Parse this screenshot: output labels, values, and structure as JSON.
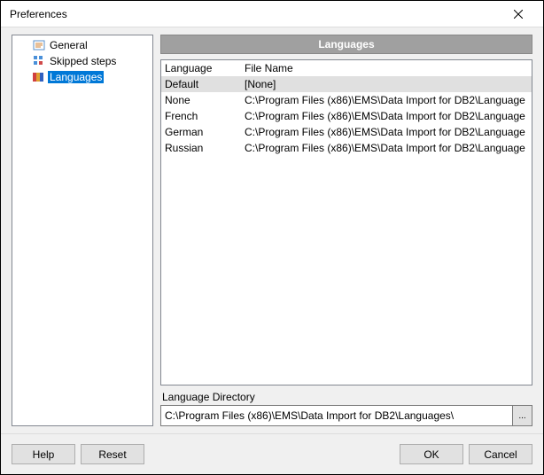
{
  "window": {
    "title": "Preferences"
  },
  "tree": {
    "items": [
      {
        "label": "General",
        "selected": false
      },
      {
        "label": "Skipped steps",
        "selected": false
      },
      {
        "label": "Languages",
        "selected": true
      }
    ]
  },
  "section": {
    "title": "Languages"
  },
  "grid": {
    "headers": {
      "language": "Language",
      "filename": "File Name"
    },
    "rows": [
      {
        "language": "Default",
        "filename": "[None]",
        "selected": true
      },
      {
        "language": "None",
        "filename": "C:\\Program Files (x86)\\EMS\\Data Import for DB2\\Language"
      },
      {
        "language": "French",
        "filename": "C:\\Program Files (x86)\\EMS\\Data Import for DB2\\Language"
      },
      {
        "language": "German",
        "filename": "C:\\Program Files (x86)\\EMS\\Data Import for DB2\\Language"
      },
      {
        "language": "Russian",
        "filename": "C:\\Program Files (x86)\\EMS\\Data Import for DB2\\Language"
      }
    ]
  },
  "directory": {
    "label": "Language Directory",
    "value": "C:\\Program Files (x86)\\EMS\\Data Import for DB2\\Languages\\",
    "browse": "..."
  },
  "buttons": {
    "help": "Help",
    "reset": "Reset",
    "ok": "OK",
    "cancel": "Cancel"
  }
}
